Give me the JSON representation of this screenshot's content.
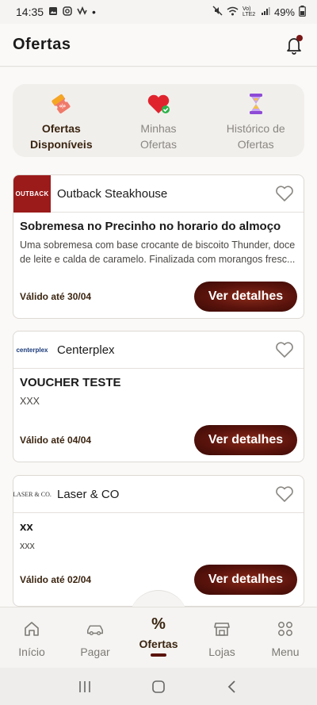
{
  "status_bar": {
    "time": "14:35",
    "dot": "•",
    "network": "Vo) LTE2",
    "battery": "49%"
  },
  "header": {
    "title": "Ofertas"
  },
  "categories": [
    {
      "label": "Ofertas\nDisponíveis",
      "icon": "ticket-icon",
      "active": true
    },
    {
      "label": "Minhas\nOfertas",
      "icon": "heart-check-icon",
      "active": false
    },
    {
      "label": "Histórico de\nOfertas",
      "icon": "hourglass-icon",
      "active": false
    }
  ],
  "offers": [
    {
      "store": "Outback Steakhouse",
      "logo_text": "OUTBACK",
      "title": "Sobremesa no Precinho no horario do almoço",
      "description": "Uma sobremesa com base crocante de biscoito Thunder, doce de leite e calda de caramelo. Finalizada com morangos fresc...",
      "valid": "Válido até 30/04",
      "button": "Ver detalhes"
    },
    {
      "store": "Centerplex",
      "logo_text": "centerplex",
      "title": "VOUCHER TESTE",
      "description": "XXX",
      "valid": "Válido até 04/04",
      "button": "Ver detalhes"
    },
    {
      "store": "Laser & CO",
      "logo_text": "LASER & CO.",
      "title": "xx",
      "description": "xxx",
      "valid": "Válido até 02/04",
      "button": "Ver detalhes"
    }
  ],
  "bottom_nav": {
    "items": [
      {
        "label": "Início",
        "icon": "home-icon"
      },
      {
        "label": "Pagar",
        "icon": "car-icon"
      },
      {
        "label": "Ofertas",
        "icon": "percent-icon",
        "glyph": "%"
      },
      {
        "label": "Lojas",
        "icon": "store-icon"
      },
      {
        "label": "Menu",
        "icon": "grid-icon"
      }
    ]
  },
  "colors": {
    "accent": "#5a130c",
    "text_dark": "#3b2511",
    "outback_red": "#9b1b1b"
  }
}
